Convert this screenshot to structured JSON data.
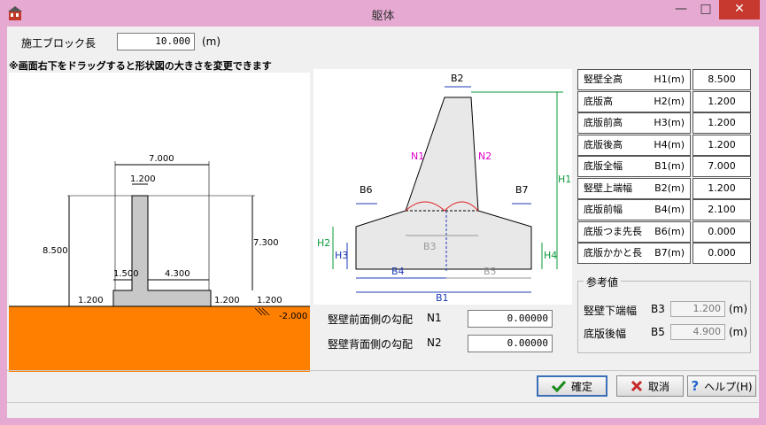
{
  "window": {
    "title": "躯体"
  },
  "form": {
    "block_length_label": "施工ブロック長",
    "block_length_value": "10.000",
    "block_length_unit": "(m)",
    "note": "※画面右下をドラッグすると形状図の大きさを変更できます"
  },
  "left_diagram": {
    "dim_top": "7.000",
    "dim_stem": "1.200",
    "dim_h1": "8.500",
    "dim_right": "7.300",
    "dim_toe": "1.500",
    "dim_heel": "4.300",
    "dim_h3": "1.200",
    "dim_h4a": "1.200",
    "dim_h4b": "1.200",
    "ground_level": "-2.000",
    "ground_color": "#ff7f00"
  },
  "right_diagram": {
    "labels": [
      "B2",
      "N1",
      "N2",
      "H1",
      "B6",
      "B7",
      "H2",
      "H3",
      "H4",
      "B3",
      "B4",
      "B5",
      "B1"
    ]
  },
  "slopes": [
    {
      "label": "竪壁前面側の勾配",
      "code": "N1",
      "value": "0.00000"
    },
    {
      "label": "竪壁背面側の勾配",
      "code": "N2",
      "value": "0.00000"
    }
  ],
  "dimensions": [
    {
      "name": "竪壁全高",
      "code": "H1(m)",
      "value": "8.500"
    },
    {
      "name": "底版高",
      "code": "H2(m)",
      "value": "1.200"
    },
    {
      "name": "底版前高",
      "code": "H3(m)",
      "value": "1.200"
    },
    {
      "name": "底版後高",
      "code": "H4(m)",
      "value": "1.200"
    },
    {
      "name": "底版全幅",
      "code": "B1(m)",
      "value": "7.000"
    },
    {
      "name": "竪壁上端幅",
      "code": "B2(m)",
      "value": "1.200"
    },
    {
      "name": "底版前幅",
      "code": "B4(m)",
      "value": "2.100"
    },
    {
      "name": "底版つま先長",
      "code": "B6(m)",
      "value": "0.000"
    },
    {
      "name": "底版かかと長",
      "code": "B7(m)",
      "value": "0.000"
    }
  ],
  "reference": {
    "title": "参考値",
    "items": [
      {
        "label": "竪壁下端幅",
        "code": "B3",
        "value": "1.200",
        "unit": "(m)"
      },
      {
        "label": "底版後幅",
        "code": "B5",
        "value": "4.900",
        "unit": "(m)"
      }
    ]
  },
  "buttons": {
    "ok": "確定",
    "cancel": "取消",
    "help": "ヘルプ(H)"
  }
}
